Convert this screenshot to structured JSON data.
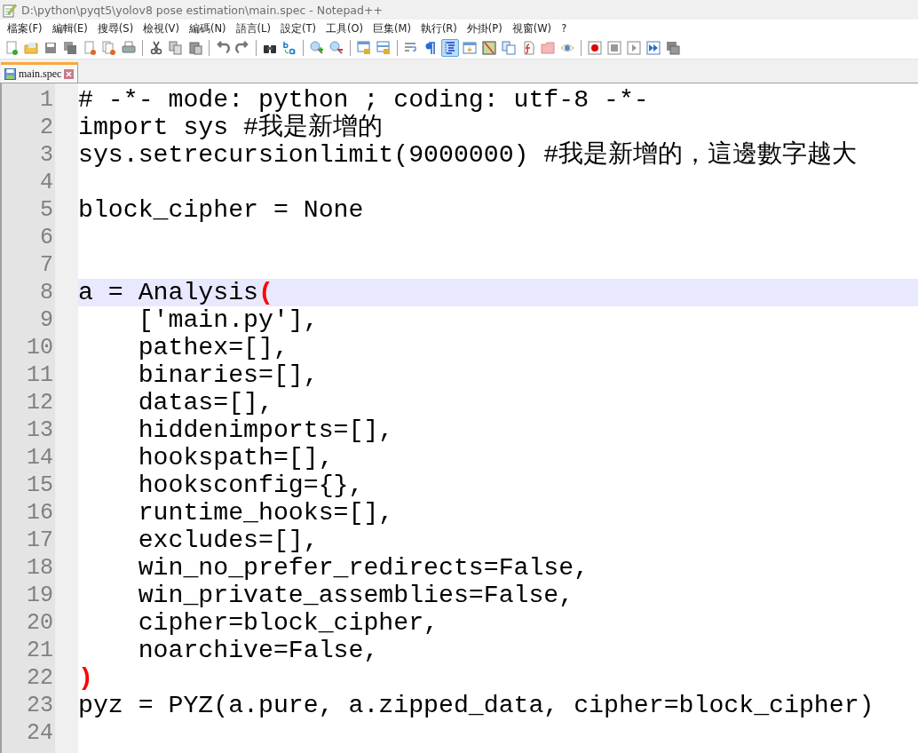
{
  "window": {
    "title": "D:\\python\\pyqt5\\yolov8 pose estimation\\main.spec - Notepad++"
  },
  "menu": [
    "檔案(F)",
    "編輯(E)",
    "搜尋(S)",
    "檢視(V)",
    "編碼(N)",
    "語言(L)",
    "設定(T)",
    "工具(O)",
    "巨集(M)",
    "執行(R)",
    "外掛(P)",
    "視窗(W)",
    "?"
  ],
  "toolbar": [
    {
      "kind": "new",
      "selected": false
    },
    {
      "kind": "open",
      "selected": false
    },
    {
      "kind": "save",
      "selected": false
    },
    {
      "kind": "save-all",
      "selected": false
    },
    {
      "kind": "close",
      "selected": false
    },
    {
      "kind": "close-all",
      "selected": false
    },
    {
      "kind": "print",
      "selected": false
    },
    {
      "kind": "sep"
    },
    {
      "kind": "cut",
      "selected": false
    },
    {
      "kind": "copy",
      "selected": false
    },
    {
      "kind": "paste",
      "selected": false
    },
    {
      "kind": "sep"
    },
    {
      "kind": "undo",
      "selected": false
    },
    {
      "kind": "redo",
      "selected": false
    },
    {
      "kind": "sep"
    },
    {
      "kind": "find",
      "selected": false
    },
    {
      "kind": "replace",
      "selected": false
    },
    {
      "kind": "sep"
    },
    {
      "kind": "zoom-in",
      "selected": false
    },
    {
      "kind": "zoom-out",
      "selected": false
    },
    {
      "kind": "sep"
    },
    {
      "kind": "sync-v",
      "selected": false
    },
    {
      "kind": "sync-h",
      "selected": false
    },
    {
      "kind": "sep"
    },
    {
      "kind": "wrap",
      "selected": false
    },
    {
      "kind": "pilcrow",
      "selected": false
    },
    {
      "kind": "indent",
      "selected": true
    },
    {
      "kind": "lang",
      "selected": false
    },
    {
      "kind": "map",
      "selected": false
    },
    {
      "kind": "docs",
      "selected": false
    },
    {
      "kind": "func",
      "selected": false
    },
    {
      "kind": "folder",
      "selected": false
    },
    {
      "kind": "eye",
      "selected": false
    },
    {
      "kind": "sep"
    },
    {
      "kind": "record",
      "selected": false
    },
    {
      "kind": "stop",
      "selected": false
    },
    {
      "kind": "play",
      "selected": false
    },
    {
      "kind": "play-multi",
      "selected": false
    },
    {
      "kind": "save-macro",
      "selected": false
    }
  ],
  "tabs": [
    {
      "label": "main.spec",
      "selected": true
    }
  ],
  "editor": {
    "lines": [
      {
        "number": "1",
        "selected": false,
        "segments": [
          {
            "text": "# -*- mode: python ; coding: utf-8 -*-",
            "kind": "plain"
          }
        ]
      },
      {
        "number": "2",
        "selected": false,
        "segments": [
          {
            "text": "import sys #我是新增的",
            "kind": "plain"
          }
        ]
      },
      {
        "number": "3",
        "selected": false,
        "segments": [
          {
            "text": "sys.setrecursionlimit(9000000) #我是新增的，這邊數字越大",
            "kind": "plain"
          }
        ]
      },
      {
        "number": "4",
        "selected": false
      },
      {
        "number": "5",
        "selected": false,
        "segments": [
          {
            "text": "block_cipher = None",
            "kind": "plain"
          }
        ]
      },
      {
        "number": "6",
        "selected": false
      },
      {
        "number": "7",
        "selected": false
      },
      {
        "number": "8",
        "selected": true,
        "segments": [
          {
            "text": "a = Analysis",
            "kind": "plain"
          },
          {
            "text": "(",
            "kind": "brace-match"
          }
        ]
      },
      {
        "number": "9",
        "selected": false,
        "segments": [
          {
            "text": "    ['main.py'],",
            "kind": "plain"
          }
        ]
      },
      {
        "number": "10",
        "selected": false,
        "segments": [
          {
            "text": "    pathex=[],",
            "kind": "plain"
          }
        ]
      },
      {
        "number": "11",
        "selected": false,
        "segments": [
          {
            "text": "    binaries=[],",
            "kind": "plain"
          }
        ]
      },
      {
        "number": "12",
        "selected": false,
        "segments": [
          {
            "text": "    datas=[],",
            "kind": "plain"
          }
        ]
      },
      {
        "number": "13",
        "selected": false,
        "segments": [
          {
            "text": "    hiddenimports=[],",
            "kind": "plain"
          }
        ]
      },
      {
        "number": "14",
        "selected": false,
        "segments": [
          {
            "text": "    hookspath=[],",
            "kind": "plain"
          }
        ]
      },
      {
        "number": "15",
        "selected": false,
        "segments": [
          {
            "text": "    hooksconfig={},",
            "kind": "plain"
          }
        ]
      },
      {
        "number": "16",
        "selected": false,
        "segments": [
          {
            "text": "    runtime_hooks=[],",
            "kind": "plain"
          }
        ]
      },
      {
        "number": "17",
        "selected": false,
        "segments": [
          {
            "text": "    excludes=[],",
            "kind": "plain"
          }
        ]
      },
      {
        "number": "18",
        "selected": false,
        "segments": [
          {
            "text": "    win_no_prefer_redirects=False,",
            "kind": "plain"
          }
        ]
      },
      {
        "number": "19",
        "selected": false,
        "segments": [
          {
            "text": "    win_private_assemblies=False,",
            "kind": "plain"
          }
        ]
      },
      {
        "number": "20",
        "selected": false,
        "segments": [
          {
            "text": "    cipher=block_cipher,",
            "kind": "plain"
          }
        ]
      },
      {
        "number": "21",
        "selected": false,
        "segments": [
          {
            "text": "    noarchive=False,",
            "kind": "plain"
          }
        ]
      },
      {
        "number": "22",
        "selected": false,
        "segments": [
          {
            "text": ")",
            "kind": "brace-match"
          }
        ]
      },
      {
        "number": "23",
        "selected": false,
        "segments": [
          {
            "text": "pyz = PYZ(a.pure, a.zipped_data, cipher=block_cipher)",
            "kind": "plain"
          }
        ]
      },
      {
        "number": "24",
        "selected": false
      }
    ]
  }
}
